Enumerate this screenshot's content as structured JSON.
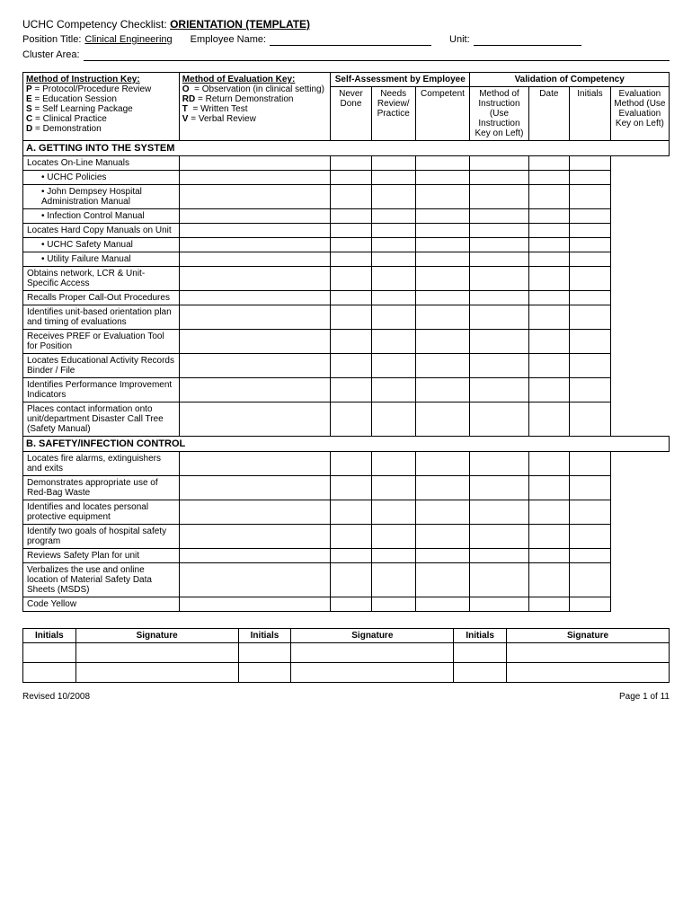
{
  "header": {
    "title": "UCHC Competency Checklist:",
    "title_bold": "ORIENTATION  (TEMPLATE)",
    "position_label": "Position Title:",
    "position_value": "Clinical Engineering",
    "employee_label": "Employee Name:",
    "employee_field": "",
    "unit_label": "Unit:",
    "unit_field": "",
    "cluster_label": "Cluster Area:",
    "cluster_field": ""
  },
  "instruction_key": {
    "title": "Method of Instruction Key:",
    "items": [
      {
        "code": "P",
        "sep": "=",
        "desc": "Protocol/Procedure Review"
      },
      {
        "code": "E",
        "sep": "=",
        "desc": "Education Session"
      },
      {
        "code": "S",
        "sep": "=",
        "desc": "Self Learning Package"
      },
      {
        "code": "C",
        "sep": "=",
        "desc": "Clinical Practice"
      },
      {
        "code": "D",
        "sep": "=",
        "desc": "Demonstration"
      }
    ]
  },
  "evaluation_key": {
    "title": "Method of Evaluation Key:",
    "items": [
      {
        "code": "O",
        "sep": "=",
        "desc": "Observation (in clinical setting)"
      },
      {
        "code": "RD",
        "sep": "=",
        "desc": "Return Demonstration"
      },
      {
        "code": "T",
        "sep": "=",
        "desc": "Written Test"
      },
      {
        "code": "V",
        "sep": "=",
        "desc": "Verbal Review"
      }
    ]
  },
  "self_assessment_header": "Self-Assessment by Employee",
  "validation_header": "Validation of Competency",
  "col_headers": {
    "never_done": "Never Done",
    "needs_review": "Needs Review/ Practice",
    "competent": "Competent",
    "method_instruction": "Method of Instruction (Use Instruction Key on Left)",
    "date": "Date",
    "initials": "Initials",
    "eval_method": "Evaluation Method (Use Evaluation Key on Left)"
  },
  "sections": [
    {
      "id": "A",
      "title": "A. GETTING INTO THE SYSTEM",
      "items": [
        {
          "text": "Locates On-Line Manuals",
          "indent": 0
        },
        {
          "text": "UCHC Policies",
          "indent": 1,
          "bullet": true
        },
        {
          "text": "John Dempsey Hospital Administration Manual",
          "indent": 1,
          "bullet": true
        },
        {
          "text": "Infection Control Manual",
          "indent": 1,
          "bullet": true
        },
        {
          "text": "Locates Hard Copy Manuals on Unit",
          "indent": 0
        },
        {
          "text": "UCHC Safety Manual",
          "indent": 1,
          "bullet": true
        },
        {
          "text": "Utility Failure Manual",
          "indent": 1,
          "bullet": true
        },
        {
          "text": "Obtains network, LCR & Unit-Specific Access",
          "indent": 0
        },
        {
          "text": "Recalls Proper Call-Out Procedures",
          "indent": 0
        },
        {
          "text": "Identifies unit-based orientation plan and timing of evaluations",
          "indent": 0
        },
        {
          "text": "Receives PREF or Evaluation Tool for Position",
          "indent": 0
        },
        {
          "text": "Locates Educational Activity Records Binder / File",
          "indent": 0
        },
        {
          "text": "Identifies Performance Improvement Indicators",
          "indent": 0
        },
        {
          "text": "Places contact information onto unit/department Disaster Call Tree (Safety Manual)",
          "indent": 0
        }
      ]
    },
    {
      "id": "B",
      "title": "B. SAFETY/INFECTION CONTROL",
      "items": [
        {
          "text": "Locates fire alarms, extinguishers and exits",
          "indent": 0
        },
        {
          "text": "Demonstrates appropriate use of Red-Bag Waste",
          "indent": 0
        },
        {
          "text": "Identifies and locates personal protective equipment",
          "indent": 0
        },
        {
          "text": "Identify two goals of hospital safety program",
          "indent": 0
        },
        {
          "text": "Reviews Safety Plan for unit",
          "indent": 0
        },
        {
          "text": "Verbalizes the use and online location of Material Safety Data Sheets (MSDS)",
          "indent": 0
        },
        {
          "text": "Code Yellow",
          "indent": 0
        }
      ]
    }
  ],
  "signature_table": {
    "headers": [
      "Initials",
      "Signature",
      "Initials",
      "Signature",
      "Initials",
      "Signature"
    ],
    "rows": [
      [
        "",
        "",
        "",
        "",
        "",
        ""
      ],
      [
        "",
        "",
        "",
        "",
        "",
        ""
      ]
    ]
  },
  "footer": {
    "left": "Revised 10/2008",
    "right": "Page 1 of 11"
  }
}
